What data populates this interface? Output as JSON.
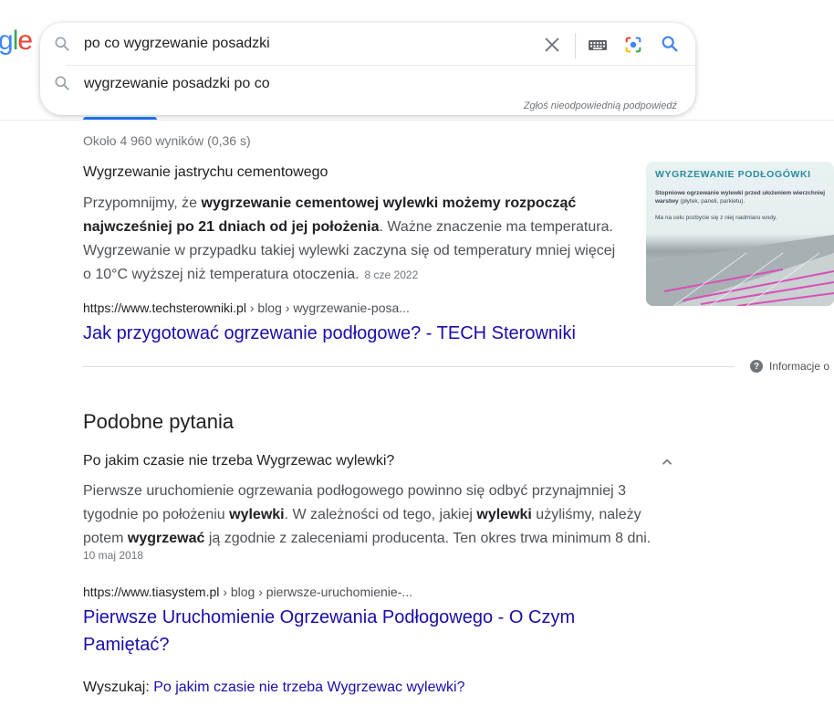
{
  "logo": {
    "g": "g",
    "l": "l",
    "e": "e"
  },
  "search": {
    "query": "po co wygrzewanie posadzki",
    "suggestion": "wygrzewanie posadzki po co",
    "report_link": "Zgłoś nieodpowiednią podpowiedź"
  },
  "results": {
    "stats": "Około 4 960 wyników (0,36 s)",
    "snippet_title": "Wygrzewanie jastrychu cementowego",
    "snippet_text_1": "Przypomnijmy, że ",
    "snippet_bold": "wygrzewanie cementowej wylewki możemy rozpocząć najwcześniej po 21 dniach od jej położenia",
    "snippet_text_2": ". Ważne znaczenie ma temperatura. Wygrzewanie w przypadku takiej wylewki zaczyna się od temperatury mniej więcej o 10°C wyższej niż temperatura otoczenia.",
    "snippet_date": "8 cze 2022",
    "thumb_title": "WYGRZEWANIE PODŁOGÓWKI",
    "thumb_text_1_bold": "Stopniowe ogrzewanie wylewki przed ułożeniem wierzchniej warstwy",
    "thumb_text_1": " (płytek, paneli, parkietu).",
    "thumb_text_2": "Ma na celu pozbycie się z niej nadmiaru wody.",
    "cite_domain": "https://www.techsterowniki.pl",
    "cite_path": " › blog › wygrzewanie-posa...",
    "link_title": "Jak przygotować ogrzewanie podłogowe? - TECH Sterowniki",
    "info_label": "Informacje o"
  },
  "paa": {
    "heading": "Podobne pytania",
    "question": "Po jakim czasie nie trzeba Wygrzewac wylewki?",
    "ans_1": "Pierwsze uruchomienie ogrzewania podłogowego powinno się odbyć przynajmniej 3 tygodnie po położeniu ",
    "ans_b1": "wylewki",
    "ans_2": ". W zależności od tego, jakiej ",
    "ans_b2": "wylewki",
    "ans_3": " użyliśmy, należy potem ",
    "ans_b3": "wygrzewać",
    "ans_4": " ją zgodnie z zaleceniami producenta. Ten okres trwa minimum 8 dni.",
    "date": "10 maj 2018",
    "cite_domain": "https://www.tiasystem.pl",
    "cite_path": " › blog › pierwsze-uruchomienie-...",
    "link_title": "Pierwsze Uruchomienie Ogrzewania Podłogowego - O Czym Pamiętać?",
    "search_for_label": "Wyszukaj: ",
    "search_for_link": "Po jakim czasie nie trzeba Wygrzewac wylewki?"
  },
  "icons": [
    "search-icon",
    "clear-icon",
    "keyboard-icon",
    "camera-icon",
    "search-submit-icon",
    "info-icon",
    "chevron-up-icon"
  ],
  "colors": {
    "link": "#1a0dab",
    "accent": "#1a73e8",
    "google_blue": "#4285f4"
  }
}
